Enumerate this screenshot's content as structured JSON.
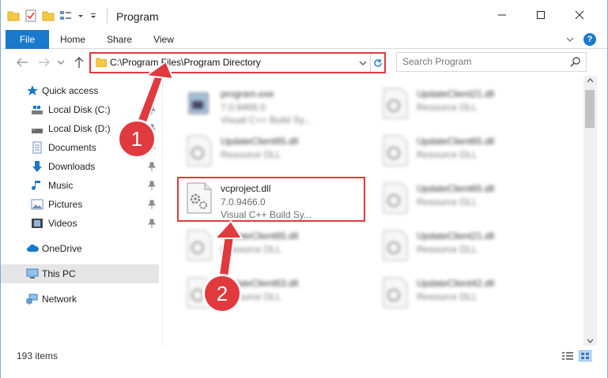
{
  "window": {
    "title": "Program",
    "colors": {
      "accent": "#1979ca",
      "annotation": "#e0393e"
    }
  },
  "ribbon": {
    "tabs": [
      {
        "label": "File"
      },
      {
        "label": "Home"
      },
      {
        "label": "Share"
      },
      {
        "label": "View"
      }
    ]
  },
  "navigation": {
    "address": "C:\\Program Files\\Program Directory",
    "search_placeholder": "Search Program"
  },
  "sidebar": {
    "items": [
      {
        "label": "Quick access",
        "icon": "star-icon"
      },
      {
        "label": "Local Disk (C:)",
        "icon": "drive-icon",
        "pinned": true
      },
      {
        "label": "Local Disk (D:)",
        "icon": "drive-icon",
        "pinned": true
      },
      {
        "label": "Documents",
        "icon": "document-icon",
        "pinned": true
      },
      {
        "label": "Downloads",
        "icon": "download-icon",
        "pinned": true
      },
      {
        "label": "Music",
        "icon": "music-icon",
        "pinned": true
      },
      {
        "label": "Pictures",
        "icon": "picture-icon",
        "pinned": true
      },
      {
        "label": "Videos",
        "icon": "video-icon",
        "pinned": true
      },
      {
        "label": "OneDrive",
        "icon": "cloud-icon"
      },
      {
        "label": "This PC",
        "icon": "computer-icon",
        "selected": true
      },
      {
        "label": "Network",
        "icon": "network-icon"
      }
    ]
  },
  "files": [
    {
      "name": "program.exe",
      "line2": "7.0.9466.0",
      "line3": "Visual C++ Build Sy...",
      "icon": "exe-icon",
      "blurred": true
    },
    {
      "name": "UpdateClient21.dll",
      "line2": "Resource DLL",
      "line3": "",
      "icon": "dll-icon",
      "blurred": true
    },
    {
      "name": "UpdateClient65.dll",
      "line2": "Resource DLL",
      "line3": "",
      "icon": "dll-icon",
      "blurred": true
    },
    {
      "name": "UpdateClient65.dll",
      "line2": "Resource DLL",
      "line3": "",
      "icon": "dll-icon",
      "blurred": true
    },
    {
      "name": "vcproject.dll",
      "line2": "7.0.9466.0",
      "line3": "Visual C++ Build Sy...",
      "icon": "dll-icon",
      "blurred": false
    },
    {
      "name": "UpdateClient65.dll",
      "line2": "Resource DLL",
      "line3": "",
      "icon": "dll-icon",
      "blurred": true
    },
    {
      "name": "UpdateClient65.dll",
      "line2": "Resource DLL",
      "line3": "",
      "icon": "dll-icon",
      "blurred": true
    },
    {
      "name": "UpdateClient21.dll",
      "line2": "Resource DLL",
      "line3": "",
      "icon": "dll-icon",
      "blurred": true
    },
    {
      "name": "UpdateClient63.dll",
      "line2": "Resource DLL",
      "line3": "",
      "icon": "dll-icon",
      "blurred": true
    },
    {
      "name": "UpdateClient42.dll",
      "line2": "Resource DLL",
      "line3": "",
      "icon": "dll-icon",
      "blurred": true
    }
  ],
  "status": {
    "item_count": "193 items"
  },
  "annotations": {
    "step1": "1",
    "step2": "2"
  }
}
